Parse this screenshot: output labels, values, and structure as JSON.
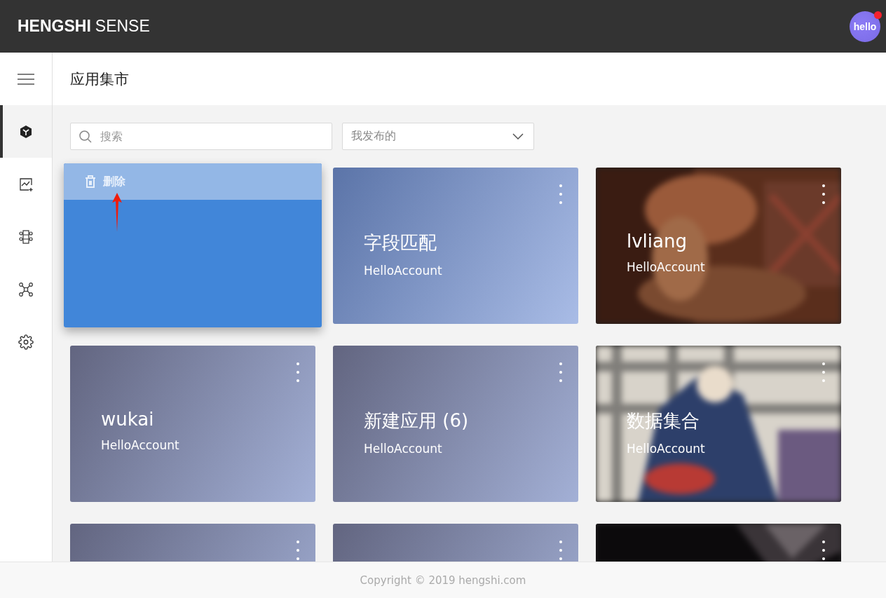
{
  "header": {
    "brand_bold": "HENGSHI",
    "brand_light": "SENSE",
    "avatar": "hello",
    "notification": true
  },
  "sidebar": {
    "items": [
      {
        "selected": true
      },
      {
        "selected": false
      },
      {
        "selected": false
      },
      {
        "selected": false
      },
      {
        "selected": false
      }
    ]
  },
  "page": {
    "title": "应用集市"
  },
  "search": {
    "placeholder": "搜索"
  },
  "filter": {
    "value": "我发布的"
  },
  "dragged_card": {
    "action": "删除",
    "annotation_arrow": true
  },
  "cards": [
    {
      "title": "字段匹配",
      "owner": "HelloAccount",
      "kind": "gradient"
    },
    {
      "title": "lvliang",
      "owner": "HelloAccount",
      "kind": "picture"
    },
    {
      "title": "wukai",
      "owner": "HelloAccount",
      "kind": "gradient"
    },
    {
      "title": "新建应用 (6)",
      "owner": "HelloAccount",
      "kind": "gradient"
    },
    {
      "title": "数据集合",
      "owner": "HelloAccount",
      "kind": "picture"
    },
    {
      "kind": "gradient"
    },
    {
      "kind": "gradient"
    },
    {
      "kind": "picture"
    }
  ],
  "footer": "Copyright © 2019 hengshi.com"
}
